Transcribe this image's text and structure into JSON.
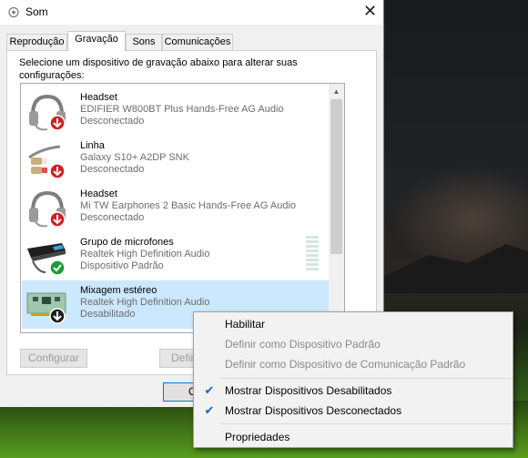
{
  "window": {
    "title": "Som"
  },
  "tabs": [
    {
      "label": "Reprodução",
      "active": false
    },
    {
      "label": "Gravação",
      "active": true
    },
    {
      "label": "Sons",
      "active": false
    },
    {
      "label": "Comunicações",
      "active": false
    }
  ],
  "instructions": "Selecione um dispositivo de gravação abaixo para alterar suas configurações:",
  "devices": [
    {
      "name": "Headset",
      "description": "EDIFIER W800BT Plus Hands-Free AG Audio",
      "status": "Desconectado",
      "icon": "headset-icon",
      "badge": "disconnected-arrow-icon"
    },
    {
      "name": "Linha",
      "description": "Galaxy S10+ A2DP SNK",
      "status": "Desconectado",
      "icon": "line-in-cable-icon",
      "badge": "disconnected-arrow-icon"
    },
    {
      "name": "Headset",
      "description": "Mi TW Earphones 2 Basic Hands-Free AG Audio",
      "status": "Desconectado",
      "icon": "headset-icon",
      "badge": "disconnected-arrow-icon"
    },
    {
      "name": "Grupo de microfones",
      "description": "Realtek High Definition Audio",
      "status": "Dispositivo Padrão",
      "icon": "microphone-array-icon",
      "badge": "default-check-icon"
    },
    {
      "name": "Mixagem estéreo",
      "description": "Realtek High Definition Audio",
      "status": "Desabilitado",
      "icon": "sound-card-icon",
      "badge": "disabled-arrow-icon"
    }
  ],
  "buttons": {
    "configure": "Configurar",
    "set_default": "Defin",
    "ok": "O"
  },
  "context_menu": {
    "items": [
      {
        "label": "Habilitar",
        "enabled": true,
        "checked": false
      },
      {
        "label": "Definir como Dispositivo Padrão",
        "enabled": false,
        "checked": false
      },
      {
        "label": "Definir como Dispositivo de Comunicação Padrão",
        "enabled": false,
        "checked": false
      },
      {
        "label": "Mostrar Dispositivos Desabilitados",
        "enabled": true,
        "checked": true
      },
      {
        "label": "Mostrar Dispositivos Desconectados",
        "enabled": true,
        "checked": true
      },
      {
        "label": "Propriedades",
        "enabled": true,
        "checked": false
      }
    ]
  },
  "colors": {
    "selection": "#cce8ff",
    "disconnected_badge": "#d11f1f",
    "default_badge": "#1e9a3a",
    "check_mark": "#1a5fd0"
  }
}
